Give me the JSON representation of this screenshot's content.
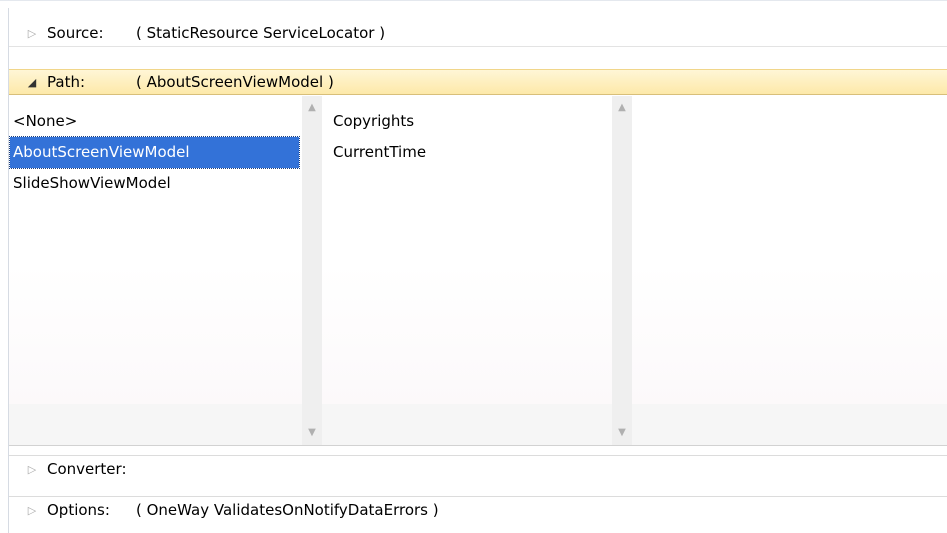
{
  "source": {
    "label": "Source:",
    "value": "( StaticResource ServiceLocator )"
  },
  "path": {
    "label": "Path:",
    "value": "( AboutScreenViewModel )"
  },
  "left_list": {
    "items": [
      "<None>",
      "AboutScreenViewModel",
      "SlideShowViewModel"
    ],
    "selected": "AboutScreenViewModel"
  },
  "right_list": {
    "items": [
      "Copyrights",
      "CurrentTime"
    ]
  },
  "converter": {
    "label": "Converter:",
    "value": ""
  },
  "options": {
    "label": "Options:",
    "value": "( OneWay ValidatesOnNotifyDataErrors )"
  },
  "icons": {
    "collapsed": "triangle-right-icon",
    "expanded": "triangle-down-icon",
    "scroll_up": "scroll-up-arrow-icon",
    "scroll_down": "scroll-down-arrow-icon"
  },
  "colors": {
    "selection": "#3372d8",
    "header_highlight": "#fde9a9"
  }
}
